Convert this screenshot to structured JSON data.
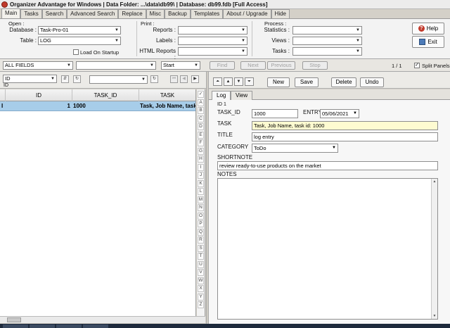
{
  "window": {
    "title": "Organizer Advantage for Windows | Data Folder: ...\\data\\db99\\ | Database: db99.fdb [Full Access]"
  },
  "main_tabs": [
    "Main",
    "Tasks",
    "Search",
    "Advanced Search",
    "Replace",
    "Misc",
    "Backup",
    "Templates",
    "About / Upgrade",
    "Hide"
  ],
  "open_group": {
    "label": "Open :",
    "database_label": "Database :",
    "database_value": "Task-Pro-01",
    "table_label": "Table :",
    "table_value": "LOG",
    "load_on_startup_label": "Load On Startup"
  },
  "print_group": {
    "label": "Print :",
    "reports_label": "Reports :",
    "labels_label": "Labels :",
    "html_reports_label": "HTML Reports :"
  },
  "process_group": {
    "label": "Process :",
    "statistics_label": "Statistics :",
    "views_label": "Views :",
    "tasks_label": "Tasks :"
  },
  "side_buttons": {
    "help": "Help",
    "exit": "Exit"
  },
  "filter_bar": {
    "field_select": "ALL FIELDS",
    "search_value": "",
    "match_select": "Start",
    "find": "Find",
    "next": "Next",
    "previous": "Previous",
    "stop": "Stop",
    "record_count": "1 / 1",
    "split_panels": "Split Panels"
  },
  "left_toolbar": {
    "sort_field": "ID",
    "sort_caption": "ID",
    "filter_value": ""
  },
  "grid": {
    "columns": [
      "ID",
      "TASK_ID",
      "TASK"
    ],
    "row_indicator": "I",
    "rows": [
      {
        "id": "1",
        "task_id": "1000",
        "task": "Task, Job Name, task id: 1000"
      }
    ]
  },
  "alphabet": [
    "✓",
    "A",
    "B",
    "C",
    "D",
    "E",
    "F",
    "G",
    "H",
    "I",
    "J",
    "K",
    "L",
    "M",
    "N",
    "O",
    "P",
    "Q",
    "R",
    "S",
    "T",
    "U",
    "V",
    "W",
    "X",
    "Y",
    "Z"
  ],
  "right_toolbar": {
    "new": "New",
    "save": "Save",
    "delete": "Delete",
    "undo": "Undo"
  },
  "detail_tabs": [
    "Log",
    "View"
  ],
  "form": {
    "id_caption": "ID 1",
    "task_id_label": "TASK_ID",
    "task_id_value": "1000",
    "entry_label": "ENTRY",
    "entry_value": "05/06/2021",
    "task_label": "TASK",
    "task_value": "Task, Job Name, task id: 1000",
    "title_label": "TITLE",
    "title_value": "log entry",
    "category_label": "CATEGORY",
    "category_value": "ToDo",
    "shortnote_label": "SHORTNOTE",
    "shortnote_value": "review ready-to-use products on the market",
    "notes_label": "NOTES",
    "notes_value": ""
  },
  "colors": {
    "selected_row": "#a7cde9",
    "task_highlight": "#fefbd1"
  }
}
